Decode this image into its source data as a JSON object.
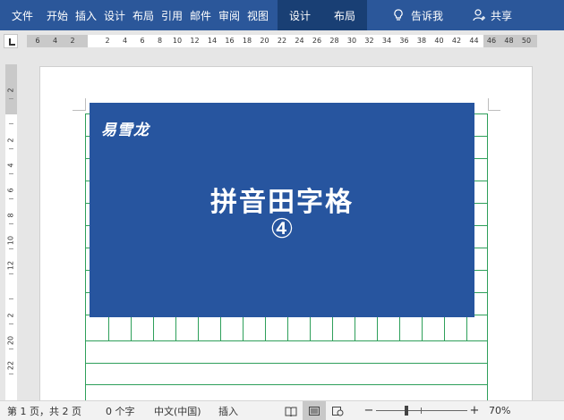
{
  "ribbon": {
    "file_tab": "文件",
    "tabs": [
      "开始",
      "插入",
      "设计",
      "布局",
      "引用",
      "邮件",
      "审阅",
      "视图"
    ],
    "context_tabs": [
      "设计",
      "布局"
    ],
    "tell_me": "告诉我",
    "share": "共享",
    "color": "#2b579a",
    "context_color": "#193f74"
  },
  "hruler": {
    "labels": [
      "6",
      "4",
      "2",
      "",
      "2",
      "4",
      "6",
      "8",
      "10",
      "12",
      "14",
      "16",
      "18",
      "20",
      "22",
      "24",
      "26",
      "28",
      "30",
      "32",
      "34",
      "36",
      "38",
      "40",
      "42",
      "44",
      "46",
      "48",
      "50"
    ]
  },
  "vruler": {
    "labels": [
      "2",
      "",
      "2",
      "4",
      "6",
      "8",
      "10",
      "12",
      "",
      "2",
      "20",
      "22"
    ]
  },
  "cover": {
    "brand": "易雪龙",
    "title": "拼音田字格",
    "number": "④",
    "color": "#27559f"
  },
  "status": {
    "page": "第 1 页，共 2 页",
    "words": "0 个字",
    "language": "中文(中国)",
    "mode": "插入",
    "zoom_minus": "−",
    "zoom_plus": "+",
    "zoom": "70%",
    "zoom_level_percent": 70
  },
  "grid": {
    "color": "#2e9f5a"
  }
}
